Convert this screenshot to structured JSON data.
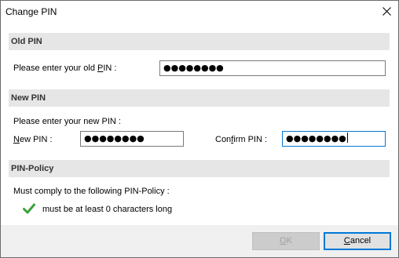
{
  "window": {
    "title": "Change PIN"
  },
  "old_pin": {
    "section_title": "Old PIN",
    "label_pre": "Please enter your old ",
    "label_mnemonic": "P",
    "label_post": "IN :",
    "value": "●●●●●●●●"
  },
  "new_pin": {
    "section_title": "New PIN",
    "prompt": "Please enter your new PIN :",
    "new_label_mnemonic": "N",
    "new_label_post": "ew PIN :",
    "new_value": "●●●●●●●●",
    "confirm_label_pre": "Con",
    "confirm_label_mnemonic": "f",
    "confirm_label_post": "irm PIN :",
    "confirm_value": "●●●●●●●●"
  },
  "policy": {
    "section_title": "PIN-Policy",
    "intro": "Must comply to the following PIN-Policy :",
    "rules": [
      {
        "icon": "check-icon",
        "text": "must be at least 0 characters long",
        "status": "ok"
      }
    ]
  },
  "buttons": {
    "ok_mnemonic": "O",
    "ok_post": "K",
    "cancel_mnemonic": "C",
    "cancel_post": "ancel"
  },
  "colors": {
    "section_bg": "#e6e6e6",
    "focus": "#0078d7",
    "check": "#3ba33b"
  }
}
